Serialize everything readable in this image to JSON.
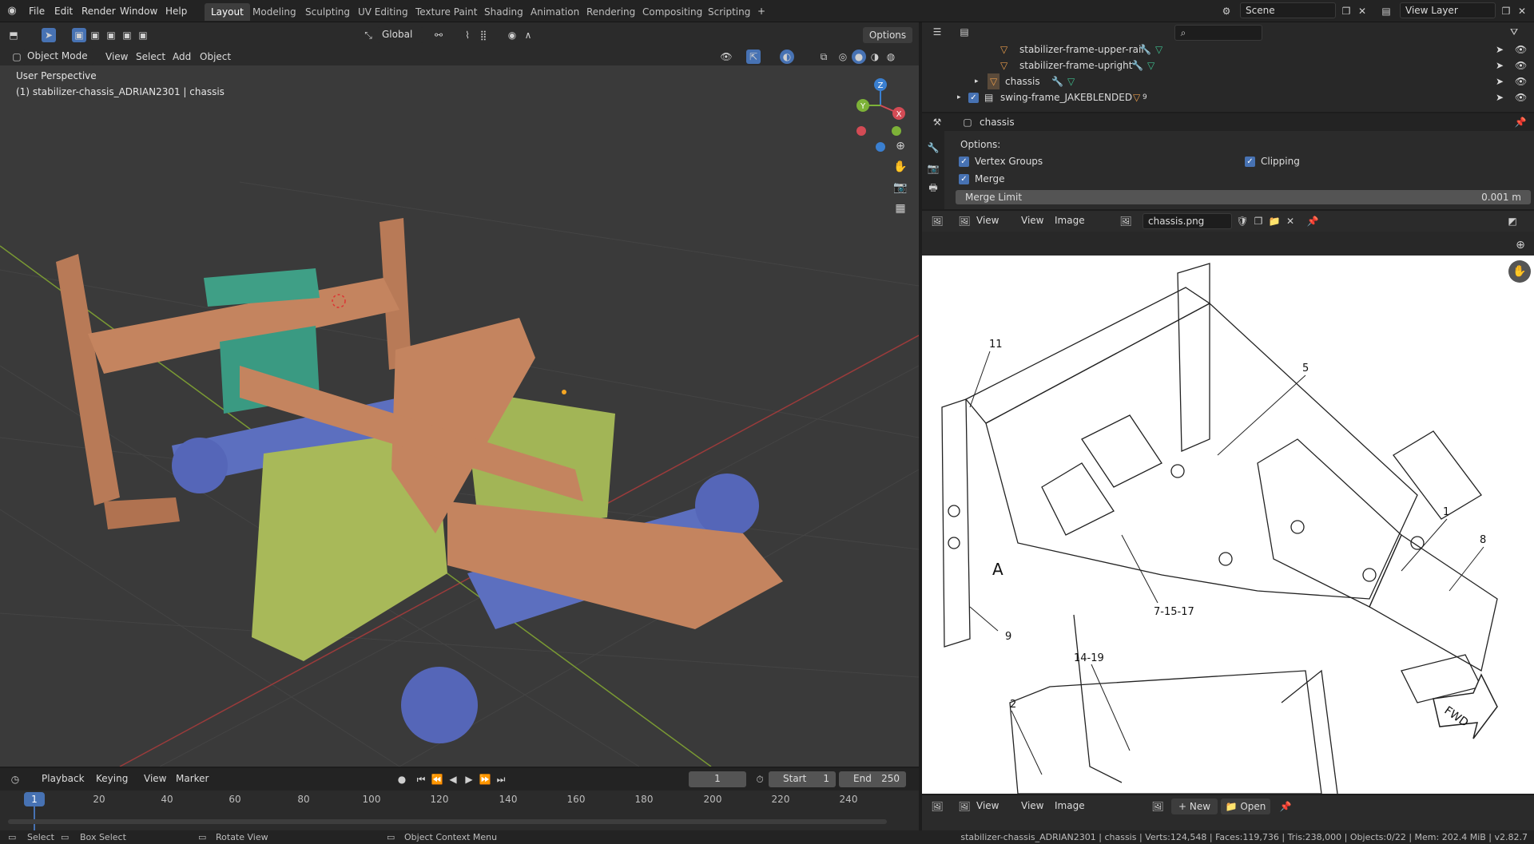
{
  "topbar": {
    "menus": [
      "File",
      "Edit",
      "Render",
      "Window",
      "Help"
    ],
    "tabs": [
      "Layout",
      "Modeling",
      "Sculpting",
      "UV Editing",
      "Texture Paint",
      "Shading",
      "Animation",
      "Rendering",
      "Compositing",
      "Scripting"
    ],
    "active_tab": "Layout",
    "scene": "Scene",
    "view_layer": "View Layer"
  },
  "viewport": {
    "transform": "Global",
    "options": "Options",
    "mode": "Object Mode",
    "menus": [
      "View",
      "Select",
      "Add",
      "Object"
    ],
    "perspective": "User Perspective",
    "active_object": "(1) stabilizer-chassis_ADRIAN2301 | chassis",
    "gizmo": {
      "x": "X",
      "y": "Y",
      "z": "Z"
    }
  },
  "outliner": {
    "rows": [
      {
        "label": "stabilizer-frame-upper-rail"
      },
      {
        "label": "stabilizer-frame-upright"
      },
      {
        "label": "chassis"
      },
      {
        "label": "swing-frame_JAKEBLENDED"
      }
    ],
    "badge": "9"
  },
  "properties": {
    "object": "chassis",
    "options_label": "Options:",
    "vertex_groups": "Vertex Groups",
    "clipping": "Clipping",
    "merge": "Merge",
    "merge_limit_label": "Merge Limit",
    "merge_limit_value": "0.001 m"
  },
  "image_editor": {
    "menus": [
      "View",
      "View",
      "Image"
    ],
    "image_name": "chassis.png",
    "callouts": [
      "11",
      "5",
      "1",
      "8",
      "A",
      "9",
      "7-15-17",
      "14-19",
      "2",
      "FWD"
    ],
    "bottom_menus": [
      "View",
      "View",
      "Image"
    ],
    "new_label": "New",
    "open_label": "Open"
  },
  "timeline": {
    "menus": [
      "Playback",
      "Keying",
      "View",
      "Marker"
    ],
    "current_frame": "1",
    "start_label": "Start",
    "start": "1",
    "end_label": "End",
    "end": "250",
    "ticks": [
      "1",
      "20",
      "40",
      "60",
      "80",
      "100",
      "120",
      "140",
      "160",
      "180",
      "200",
      "220",
      "240"
    ]
  },
  "statusbar": {
    "select": "Select",
    "box_select": "Box Select",
    "rotate": "Rotate View",
    "context": "Object Context Menu",
    "stats": "stabilizer-chassis_ADRIAN2301 | chassis | Verts:124,548 | Faces:119,736 | Tris:238,000 | Objects:0/22 | Mem: 202.4 MiB | v2.82.7"
  },
  "colors": {
    "chassis": "#c07f5c",
    "axle": "#5c6fbf",
    "fender": "#a8b959",
    "bracket": "#3f9f86",
    "accent": "#4772b3"
  }
}
